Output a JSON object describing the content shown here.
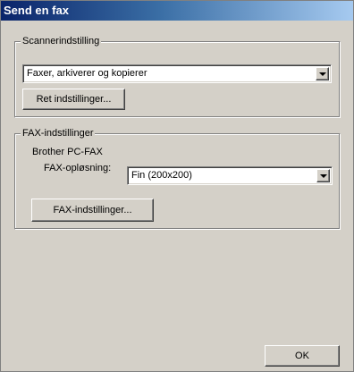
{
  "window": {
    "title": "Send en fax"
  },
  "scanner_group": {
    "label": "Scannerindstilling",
    "mode_value": "Faxer, arkiverer og kopierer",
    "settings_button": "Ret indstillinger..."
  },
  "fax_group": {
    "label": "FAX-indstillinger",
    "device_name": "Brother PC-FAX",
    "resolution_label": "FAX-opløsning:",
    "resolution_value": "Fin (200x200)",
    "settings_button": "FAX-indstillinger..."
  },
  "footer": {
    "ok_button": "OK"
  }
}
